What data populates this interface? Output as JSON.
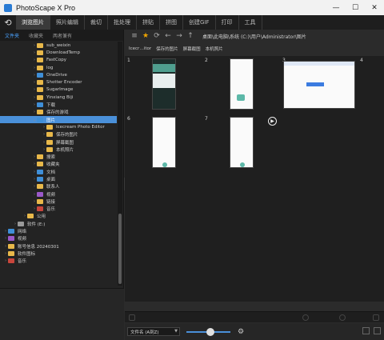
{
  "window": {
    "title": "PhotoScape X Pro",
    "controls": [
      "—",
      "☐",
      "✕"
    ]
  },
  "tabs": [
    "浏览图片",
    "照片编辑",
    "裁切",
    "批处理",
    "拼贴",
    "拼图",
    "创建GIF",
    "打印",
    "工具"
  ],
  "active_tab": "浏览图片",
  "left_tabs": [
    "文件夹",
    "收藏夹",
    "两者兼有"
  ],
  "tree": [
    {
      "label": "sub_weixin",
      "icon": "folder",
      "indent": 3
    },
    {
      "label": "DownloadTemp",
      "icon": "folder",
      "indent": 3
    },
    {
      "label": "FastCopy",
      "icon": "folder",
      "indent": 3
    },
    {
      "label": "log",
      "icon": "folder",
      "indent": 3
    },
    {
      "label": "OneDrive",
      "icon": "folder-blue",
      "indent": 3
    },
    {
      "label": "Shotter Encoder",
      "icon": "folder",
      "indent": 3
    },
    {
      "label": "SugarImage",
      "icon": "folder",
      "indent": 3
    },
    {
      "label": "Yinxiang Biji",
      "icon": "folder",
      "indent": 3
    },
    {
      "label": "下载",
      "icon": "folder-blue",
      "indent": 3
    },
    {
      "label": "保存的游戏",
      "icon": "folder",
      "indent": 3
    },
    {
      "label": "图片",
      "icon": "folder-blue",
      "indent": 3,
      "selected": true,
      "expanded": true
    },
    {
      "label": "Icecream Photo Editor",
      "icon": "folder",
      "indent": 4
    },
    {
      "label": "保存的图片",
      "icon": "folder",
      "indent": 4
    },
    {
      "label": "屏幕截图",
      "icon": "folder",
      "indent": 4
    },
    {
      "label": "本机照片",
      "icon": "folder",
      "indent": 4
    },
    {
      "label": "搜索",
      "icon": "folder",
      "indent": 3
    },
    {
      "label": "收藏夹",
      "icon": "folder",
      "indent": 3
    },
    {
      "label": "文档",
      "icon": "folder-blue",
      "indent": 3
    },
    {
      "label": "桌面",
      "icon": "folder-blue",
      "indent": 3
    },
    {
      "label": "联系人",
      "icon": "folder",
      "indent": 3
    },
    {
      "label": "视频",
      "icon": "folder-purple",
      "indent": 3
    },
    {
      "label": "链接",
      "icon": "folder",
      "indent": 3
    },
    {
      "label": "音乐",
      "icon": "folder-red",
      "indent": 3
    },
    {
      "label": "公用",
      "icon": "folder",
      "indent": 2
    },
    {
      "label": "软件 (E:)",
      "icon": "drive",
      "indent": 1
    },
    {
      "label": "网络",
      "icon": "folder-blue",
      "indent": 0
    },
    {
      "label": "视频",
      "icon": "folder-purple",
      "indent": 0
    },
    {
      "label": "账号信息 20240301",
      "icon": "folder",
      "indent": 0
    },
    {
      "label": "软件图标",
      "icon": "folder",
      "indent": 0
    },
    {
      "label": "音乐",
      "icon": "folder-red",
      "indent": 0
    }
  ],
  "path": "桌面\\此电脑\\系统 (C:)\\用户\\Administrator\\图片",
  "quick_folders": [
    "Icecr…itor",
    "保存的图片",
    "屏幕截图",
    "本机照片"
  ],
  "thumbnails": [
    {
      "num": "1",
      "style": "phone-dark"
    },
    {
      "num": "2",
      "style": "phone-light"
    },
    {
      "num": "3",
      "style": "web"
    },
    {
      "num": "4",
      "style": "blank"
    },
    {
      "num": "6",
      "style": "phone-light"
    },
    {
      "num": "7",
      "style": "phone-light"
    }
  ],
  "sort": {
    "value": "文件名 (A到Z)"
  },
  "colors": {
    "accent": "#4a90d9",
    "star": "#f0a500",
    "bg": "#2b2b2b"
  }
}
